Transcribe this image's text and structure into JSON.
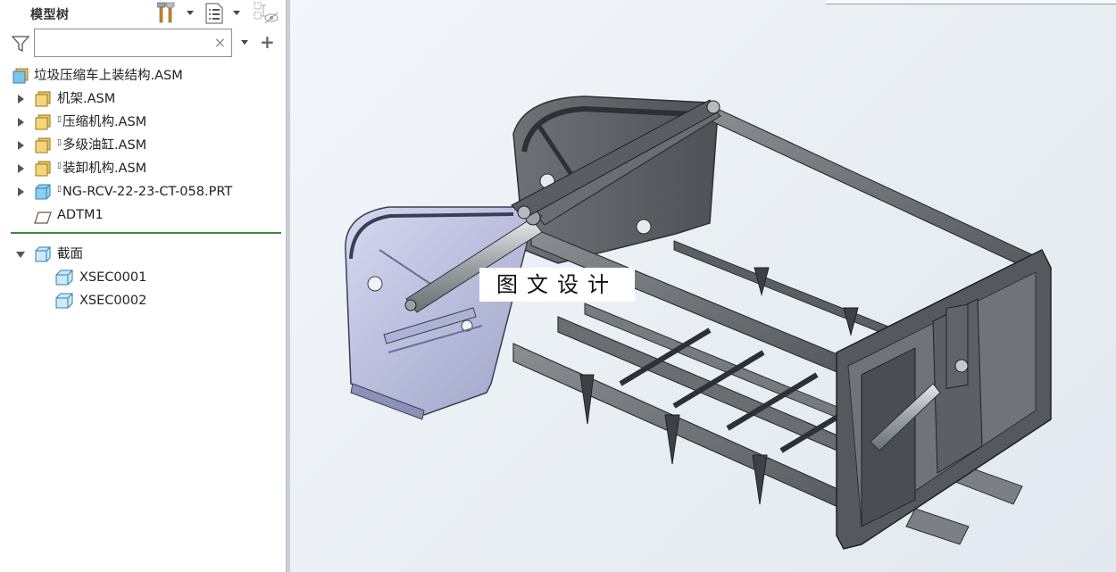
{
  "panel": {
    "title": "模型树",
    "search": {
      "value": "",
      "placeholder": "",
      "clear_glyph": "×"
    },
    "add_glyph": "+",
    "icons": [
      "hammer-settings-icon",
      "tree-display-icon",
      "show-hide-icon",
      "filter-icon"
    ]
  },
  "tree": {
    "root": {
      "label": "垃圾压缩车上装结构.ASM",
      "icon": "assembly-icon"
    },
    "items": [
      {
        "label": "机架.ASM",
        "icon": "assembly-icon",
        "marker": "",
        "expandable": true
      },
      {
        "label": "压缩机构.ASM",
        "icon": "assembly-icon",
        "marker": "▯",
        "expandable": true
      },
      {
        "label": "多级油缸.ASM",
        "icon": "assembly-icon",
        "marker": "▯",
        "expandable": true
      },
      {
        "label": "装卸机构.ASM",
        "icon": "assembly-icon",
        "marker": "▯",
        "expandable": true
      },
      {
        "label": "NG-RCV-22-23-CT-058.PRT",
        "icon": "part-icon",
        "marker": "▯",
        "expandable": true
      },
      {
        "label": "ADTM1",
        "icon": "datum-plane-icon",
        "marker": "",
        "expandable": false
      }
    ],
    "sections": {
      "label": "截面",
      "icon": "section-icon",
      "children": [
        {
          "label": "XSEC0001",
          "icon": "section-icon"
        },
        {
          "label": "XSEC0002",
          "icon": "section-icon"
        }
      ]
    }
  },
  "viewport": {
    "watermark": "图文设计",
    "model": "garbage-compactor-truck-assembly-3d-view"
  },
  "colors": {
    "panel_bg": "#ffffff",
    "divider": "#3a8a3a",
    "viewport_bg": "#eef2f6",
    "model_steel": "#6b6f73",
    "model_dark": "#3d4044",
    "model_highlight": "#b8bcd8"
  }
}
